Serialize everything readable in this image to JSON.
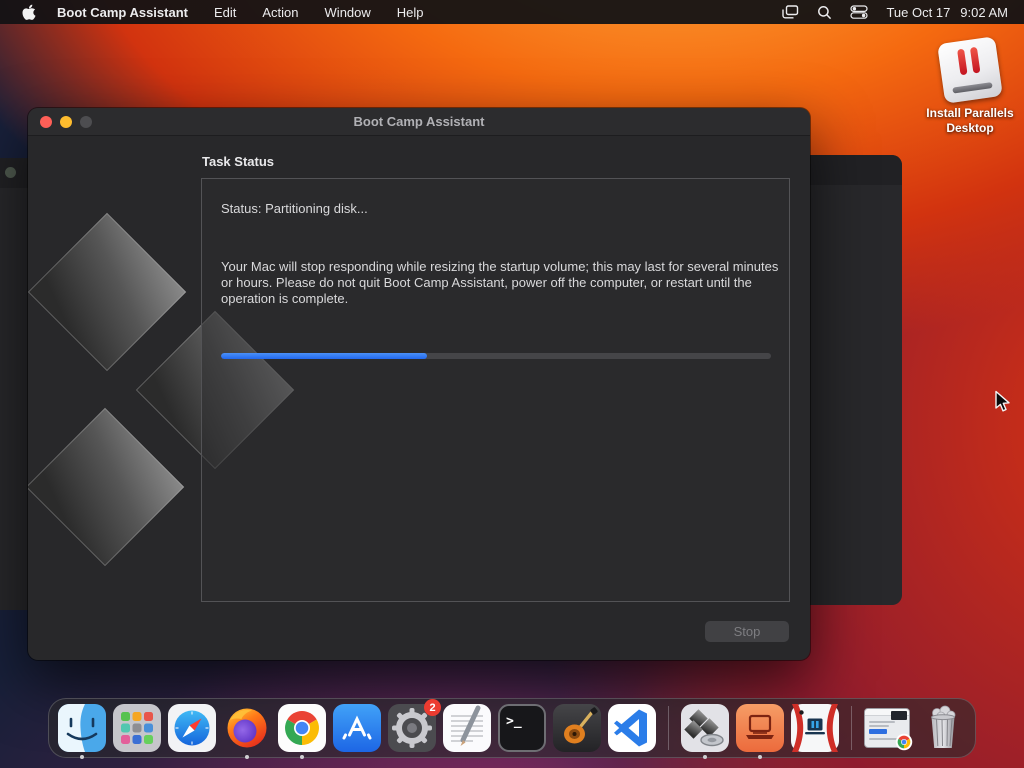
{
  "menu_bar": {
    "app_name": "Boot Camp Assistant",
    "menus": [
      "Edit",
      "Action",
      "Window",
      "Help"
    ],
    "date": "Tue Oct 17",
    "time": "9:02 AM"
  },
  "desktop": {
    "install_parallels_label": "Install Parallels Desktop"
  },
  "bootcamp_window": {
    "title": "Boot Camp Assistant",
    "section_heading": "Task Status",
    "status_line": "Status: Partitioning disk...",
    "warning_text": "Your Mac will stop responding while resizing the startup volume; this may last for several minutes or hours. Please do not quit Boot Camp Assistant, power off the computer, or restart until the operation is complete.",
    "progress_percent": 37.5,
    "progress_color": "#2e7bf5",
    "stop_button_label": "Stop"
  },
  "dock": {
    "settings_badge": "2",
    "items": [
      {
        "name": "finder",
        "running": true
      },
      {
        "name": "launchpad",
        "running": false
      },
      {
        "name": "safari",
        "running": false
      },
      {
        "name": "firefox",
        "running": true
      },
      {
        "name": "google-chrome",
        "running": true
      },
      {
        "name": "app-store",
        "running": false
      },
      {
        "name": "system-settings",
        "running": false,
        "badge": "2"
      },
      {
        "name": "textedit",
        "running": false
      },
      {
        "name": "terminal",
        "running": false
      },
      {
        "name": "garageband",
        "running": false
      },
      {
        "name": "vs-code",
        "running": false
      },
      {
        "name": "boot-camp-assistant",
        "running": true
      },
      {
        "name": "parallels-installer",
        "running": true
      },
      {
        "name": "parallels-desktop",
        "running": false
      },
      {
        "name": "minimized-window",
        "running": false
      },
      {
        "name": "trash",
        "running": false
      }
    ]
  }
}
